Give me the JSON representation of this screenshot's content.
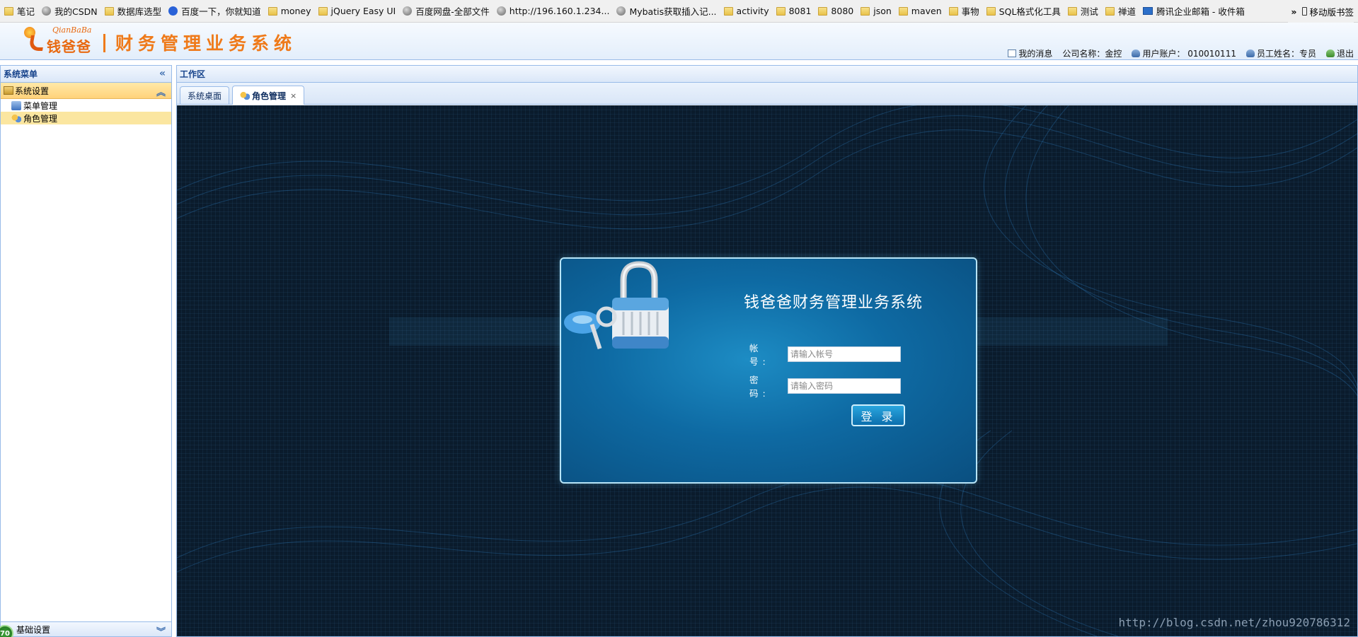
{
  "bookmarks": [
    {
      "label": "笔记",
      "icon": "folder-icon"
    },
    {
      "label": "我的CSDN",
      "icon": "globe-icon"
    },
    {
      "label": "数据库选型",
      "icon": "folder-icon"
    },
    {
      "label": "百度一下，你就知道",
      "icon": "paw-icon"
    },
    {
      "label": "money",
      "icon": "folder-icon"
    },
    {
      "label": "jQuery Easy UI",
      "icon": "folder-icon"
    },
    {
      "label": "百度网盘-全部文件",
      "icon": "globe-icon"
    },
    {
      "label": "http://196.160.1.234...",
      "icon": "globe-icon"
    },
    {
      "label": "Mybatis获取插入记...",
      "icon": "globe-icon"
    },
    {
      "label": "activity",
      "icon": "folder-icon"
    },
    {
      "label": "8081",
      "icon": "folder-icon"
    },
    {
      "label": "8080",
      "icon": "folder-icon"
    },
    {
      "label": "json",
      "icon": "folder-icon"
    },
    {
      "label": "maven",
      "icon": "folder-icon"
    },
    {
      "label": "事物",
      "icon": "folder-icon"
    },
    {
      "label": "SQL格式化工具",
      "icon": "folder-icon"
    },
    {
      "label": "测试",
      "icon": "folder-icon"
    },
    {
      "label": "禅道",
      "icon": "folder-icon"
    },
    {
      "label": "腾讯企业邮箱 - 收件箱",
      "icon": "mail-icon"
    }
  ],
  "bookmarks_more": {
    "chevron": "»",
    "mobile_label": "移动版书签"
  },
  "header": {
    "logo_script": "QianBaBa",
    "logo_text": "钱爸爸",
    "system_title": "财务管理业务系统",
    "my_messages": "我的消息",
    "company": "公司名称：金控",
    "account": "用户账户： 010010111",
    "employee": "员工姓名：专员",
    "logout": "退出"
  },
  "sidebar": {
    "title": "系统菜单",
    "collapse_glyph": "«",
    "group": "系统设置",
    "group_toggle": "︽",
    "items": [
      {
        "label": "菜单管理",
        "selected": false
      },
      {
        "label": "角色管理",
        "selected": true
      }
    ],
    "bottom_group": "基础设置",
    "bottom_toggle": "︾",
    "badge": "70"
  },
  "work": {
    "title": "工作区",
    "tabs": [
      {
        "label": "系统桌面",
        "active": false
      },
      {
        "label": "角色管理",
        "active": true,
        "close": "×"
      }
    ]
  },
  "login": {
    "title": "钱爸爸财务管理业务系统",
    "account_label": "帐　号:",
    "account_placeholder": "请输入帐号",
    "password_label": "密　码:",
    "password_placeholder": "请输入密码",
    "button": "登 录"
  },
  "watermark": "http://blog.csdn.net/zhou920786312",
  "colors": {
    "accent_orange": "#ef7a1a",
    "panel_border": "#99bbe8",
    "login_blue": "#0e6aa3",
    "selected_row": "#fbe6a0"
  }
}
